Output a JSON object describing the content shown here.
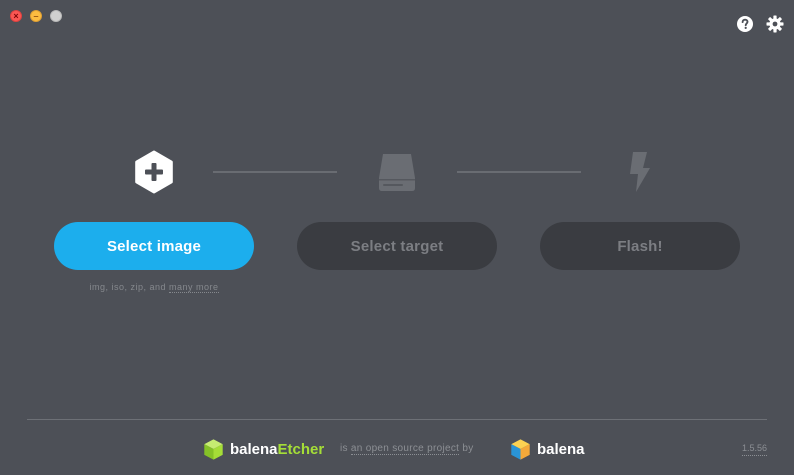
{
  "window": {
    "controls": [
      "close",
      "minimize",
      "maximize"
    ]
  },
  "header": {
    "icons": [
      "help-icon",
      "settings-icon"
    ]
  },
  "steps": {
    "image": {
      "icon": "plus-hexagon-icon",
      "button_label": "Select image",
      "hint_prefix": "img, iso, zip, and ",
      "hint_link": "many more"
    },
    "target": {
      "icon": "drive-icon",
      "button_label": "Select target"
    },
    "flash": {
      "icon": "lightning-icon",
      "button_label": "Flash!"
    }
  },
  "footer": {
    "brand_prefix": "balena",
    "brand_suffix": "Etcher",
    "tagline_prefix": "is ",
    "tagline_link": "an open source project",
    "tagline_suffix": " by",
    "company": "balena",
    "version": "1.5.56"
  },
  "colors": {
    "background": "#4d5057",
    "primary_button": "#1caeed",
    "disabled_button": "#3a3c41",
    "etcher_accent": "#a5de37"
  }
}
